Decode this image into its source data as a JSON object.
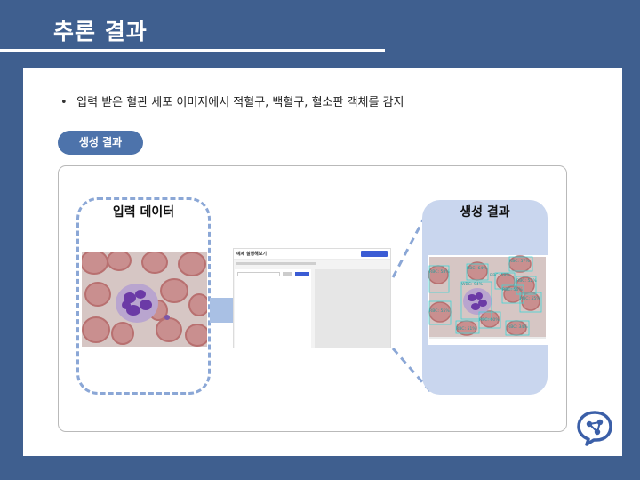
{
  "slide": {
    "title": "추론 결과",
    "bullet": "입력 받은 혈관 세포 이미지에서 적혈구, 백혈구, 혈소판 객체를 감지",
    "bullet_marker": "•",
    "pill_label": "생성 결과"
  },
  "input_panel": {
    "label": "입력 데이터"
  },
  "output_panel": {
    "label": "생성 결과",
    "detections": [
      {
        "label": "RBC: 58%"
      },
      {
        "label": "RBC: 64%"
      },
      {
        "label": "RBC: 57%"
      },
      {
        "label": "RBC: 58%"
      },
      {
        "label": "WBC: 94%"
      },
      {
        "label": "RBC: 52%"
      },
      {
        "label": "RBC: 56%"
      },
      {
        "label": "RBC: 55%"
      },
      {
        "label": "RBC: 55%"
      },
      {
        "label": "RBC: 60%"
      },
      {
        "label": "RBC: 51%"
      },
      {
        "label": "RBC: 34%"
      }
    ]
  },
  "app_mock": {
    "title": "예제 실행해보기"
  },
  "colors": {
    "background": "#3f5f8f",
    "pill": "#4d73ab",
    "dashed_border": "#8ba7d6",
    "output_fill": "#c9d6ee",
    "arrow": "#a9c0e4",
    "detection_box": "#3fd6d6"
  },
  "icons": {
    "logo": "brain-network-icon",
    "arrow": "right-arrow-icon"
  }
}
